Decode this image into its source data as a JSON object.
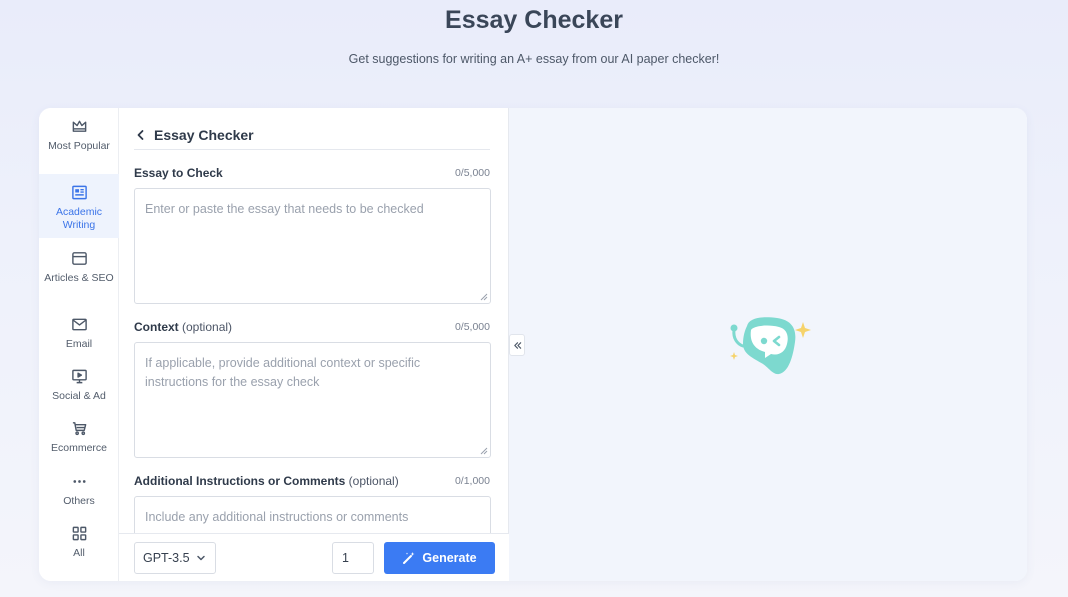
{
  "header": {
    "title": "Essay Checker",
    "subtitle": "Get suggestions for writing an A+ essay from our AI paper checker!"
  },
  "sidebar": {
    "items": [
      {
        "label": "Most Popular",
        "icon": "crown-icon"
      },
      {
        "label": "Academic Writing",
        "icon": "newspaper-icon",
        "active": true
      },
      {
        "label": "Articles & SEO",
        "icon": "browser-window-icon"
      },
      {
        "label": "Email",
        "icon": "envelope-icon"
      },
      {
        "label": "Social & Ad",
        "icon": "monitor-play-icon"
      },
      {
        "label": "Ecommerce",
        "icon": "cart-icon"
      },
      {
        "label": "Others",
        "icon": "more-dots-icon"
      },
      {
        "label": "All",
        "icon": "grid-icon"
      }
    ]
  },
  "form": {
    "back_title": "Essay Checker",
    "fields": [
      {
        "label": "Essay to Check",
        "optional": "",
        "count": "0/5,000",
        "value": "",
        "placeholder": "Enter or paste the essay that needs to be checked"
      },
      {
        "label": "Context",
        "optional": " (optional)",
        "count": "0/5,000",
        "value": "",
        "placeholder": "If applicable, provide additional context or specific instructions for the essay check"
      },
      {
        "label": "Additional Instructions or Comments",
        "optional": " (optional)",
        "count": "0/1,000",
        "value": "",
        "placeholder": "Include any additional instructions or comments"
      }
    ]
  },
  "toolbar": {
    "model": "GPT-3.5",
    "quantity": "1",
    "generate_label": "Generate"
  },
  "colors": {
    "accent": "#3b7bf3",
    "sidebar_active_bg": "#eef3fd",
    "output_bg": "#f2f5fc",
    "mascot": "#7dd9cf",
    "sparkle": "#f6d36b"
  }
}
